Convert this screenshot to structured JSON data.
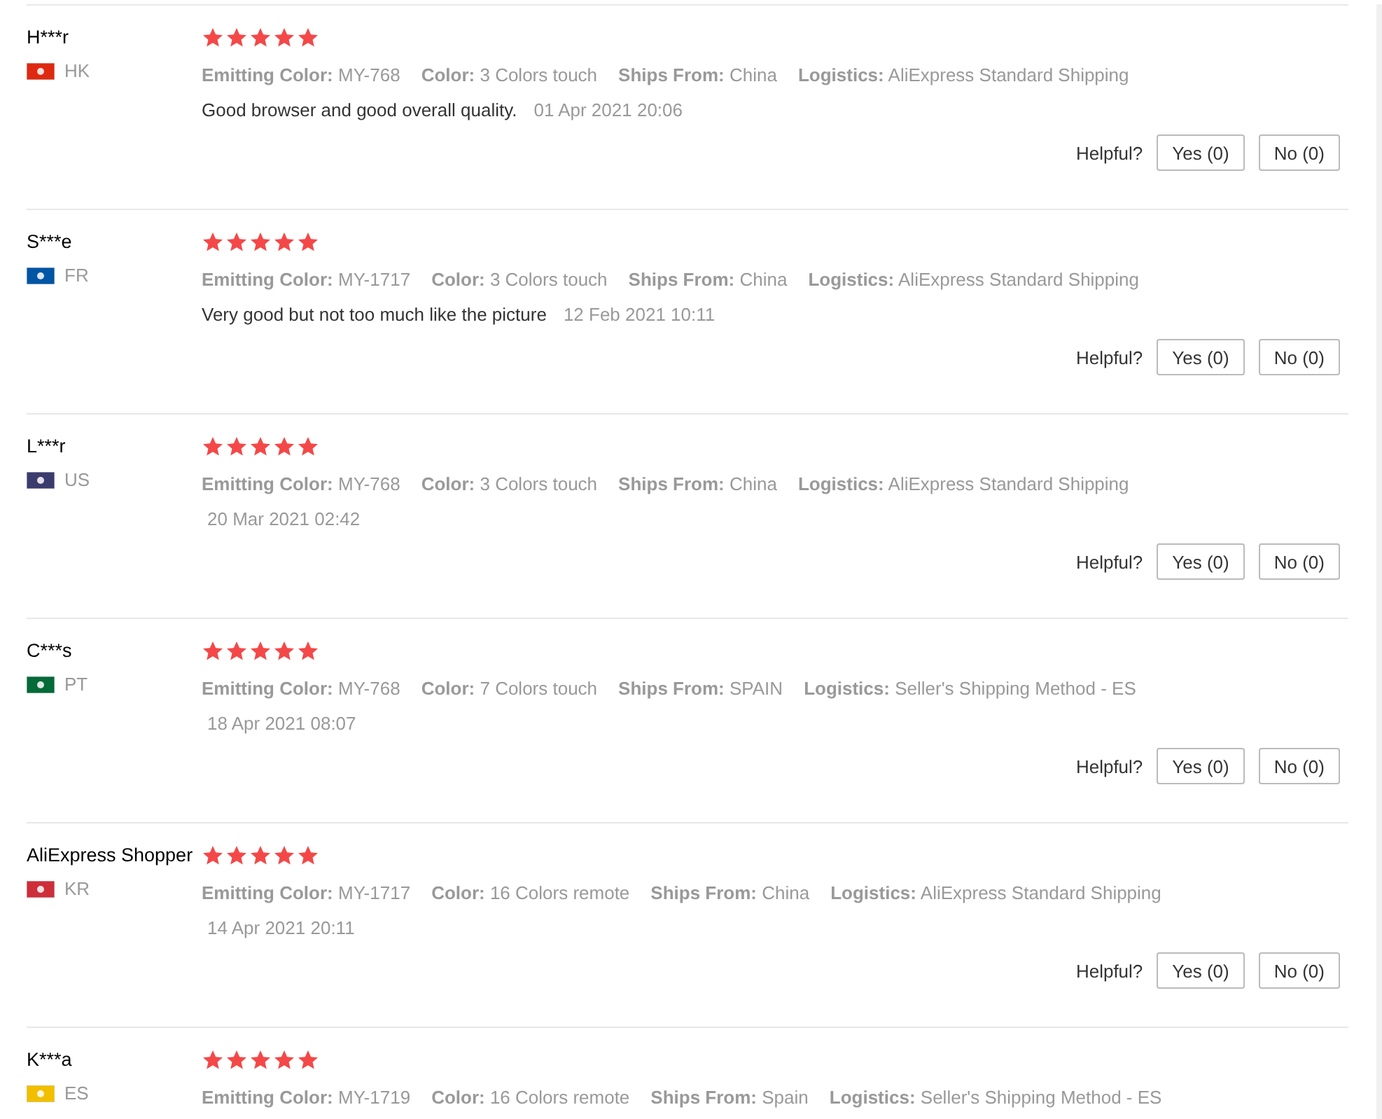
{
  "reviews": [
    {
      "name": "H***r",
      "country": "HK",
      "color": "#de2910",
      "stars": 5,
      "attributes": [
        {
          "label": "Emitting Color:",
          "value": "MY-768"
        },
        {
          "label": "Color:",
          "value": "3 Colors touch"
        },
        {
          "label": "Ships From:",
          "value": "China"
        },
        {
          "label": "Logistics:",
          "value": "AliExpress Standard Shipping"
        }
      ],
      "comment": "Good browser and good overall quality.",
      "date": "01 Apr 2021 20:06",
      "helpful": "Helpful?",
      "yes": "Yes (0)",
      "no": "No (0)"
    },
    {
      "name": "S***e",
      "country": "FR",
      "color": "#0055a4",
      "stars": 5,
      "attributes": [
        {
          "label": "Emitting Color:",
          "value": "MY-1717"
        },
        {
          "label": "Color:",
          "value": "3 Colors touch"
        },
        {
          "label": "Ships From:",
          "value": "China"
        },
        {
          "label": "Logistics:",
          "value": "AliExpress Standard Shipping"
        }
      ],
      "comment": "Very good but not too much like the picture",
      "date": "12 Feb 2021 10:11",
      "helpful": "Helpful?",
      "yes": "Yes (0)",
      "no": "No (0)"
    },
    {
      "name": "L***r",
      "country": "US",
      "color": "#3c3b6e",
      "stars": 5,
      "attributes": [
        {
          "label": "Emitting Color:",
          "value": "MY-768"
        },
        {
          "label": "Color:",
          "value": "3 Colors touch"
        },
        {
          "label": "Ships From:",
          "value": "China"
        },
        {
          "label": "Logistics:",
          "value": "AliExpress Standard Shipping"
        }
      ],
      "date": "20 Mar 2021 02:42",
      "helpful": "Helpful?",
      "yes": "Yes (0)",
      "no": "No (0)"
    },
    {
      "name": "C***s",
      "country": "PT",
      "color": "#046a38",
      "stars": 5,
      "attributes": [
        {
          "label": "Emitting Color:",
          "value": "MY-768"
        },
        {
          "label": "Color:",
          "value": "7 Colors touch"
        },
        {
          "label": "Ships From:",
          "value": "SPAIN"
        },
        {
          "label": "Logistics:",
          "value": "Seller's Shipping Method - ES"
        }
      ],
      "date": "18 Apr 2021 08:07",
      "helpful": "Helpful?",
      "yes": "Yes (0)",
      "no": "No (0)"
    },
    {
      "name": "AliExpress Shopper",
      "country": "KR",
      "color": "#cd2e3a",
      "stars": 5,
      "attributes": [
        {
          "label": "Emitting Color:",
          "value": "MY-1717"
        },
        {
          "label": "Color:",
          "value": "16 Colors remote"
        },
        {
          "label": "Ships From:",
          "value": "China"
        },
        {
          "label": "Logistics:",
          "value": "AliExpress Standard Shipping"
        }
      ],
      "date": "14 Apr 2021 20:11",
      "helpful": "Helpful?",
      "yes": "Yes (0)",
      "no": "No (0)"
    },
    {
      "name": "K***a",
      "country": "ES",
      "color": "#f1bf00",
      "stars": 5,
      "attributes": [
        {
          "label": "Emitting Color:",
          "value": "MY-1719"
        },
        {
          "label": "Color:",
          "value": "16 Colors remote"
        },
        {
          "label": "Ships From:",
          "value": "Spain"
        },
        {
          "label": "Logistics:",
          "value": "Seller's Shipping Method - ES"
        }
      ]
    }
  ]
}
